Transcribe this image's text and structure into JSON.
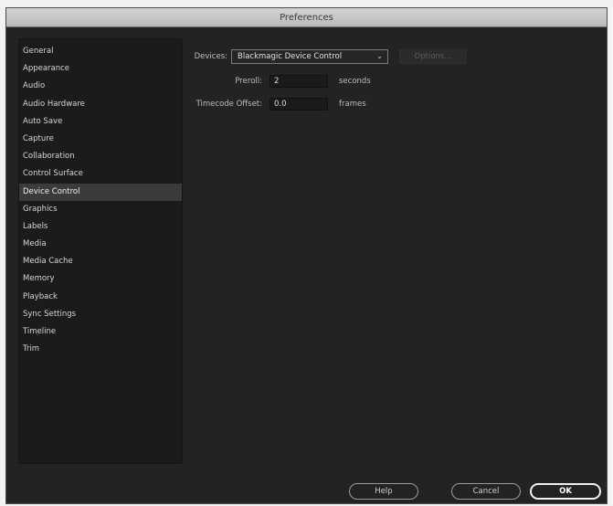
{
  "window": {
    "title": "Preferences"
  },
  "sidebar": {
    "items": [
      {
        "label": "General",
        "selected": false
      },
      {
        "label": "Appearance",
        "selected": false
      },
      {
        "label": "Audio",
        "selected": false
      },
      {
        "label": "Audio Hardware",
        "selected": false
      },
      {
        "label": "Auto Save",
        "selected": false
      },
      {
        "label": "Capture",
        "selected": false
      },
      {
        "label": "Collaboration",
        "selected": false
      },
      {
        "label": "Control Surface",
        "selected": false
      },
      {
        "label": "Device Control",
        "selected": true
      },
      {
        "label": "Graphics",
        "selected": false
      },
      {
        "label": "Labels",
        "selected": false
      },
      {
        "label": "Media",
        "selected": false
      },
      {
        "label": "Media Cache",
        "selected": false
      },
      {
        "label": "Memory",
        "selected": false
      },
      {
        "label": "Playback",
        "selected": false
      },
      {
        "label": "Sync Settings",
        "selected": false
      },
      {
        "label": "Timeline",
        "selected": false
      },
      {
        "label": "Trim",
        "selected": false
      }
    ]
  },
  "device_control": {
    "devices_label": "Devices:",
    "devices_value": "Blackmagic Device Control",
    "options_label": "Options...",
    "preroll_label": "Preroll:",
    "preroll_value": "2",
    "preroll_unit": "seconds",
    "timecode_label": "Timecode Offset:",
    "timecode_value": "0.0",
    "timecode_unit": "frames"
  },
  "footer": {
    "help_label": "Help",
    "cancel_label": "Cancel",
    "ok_label": "OK"
  }
}
